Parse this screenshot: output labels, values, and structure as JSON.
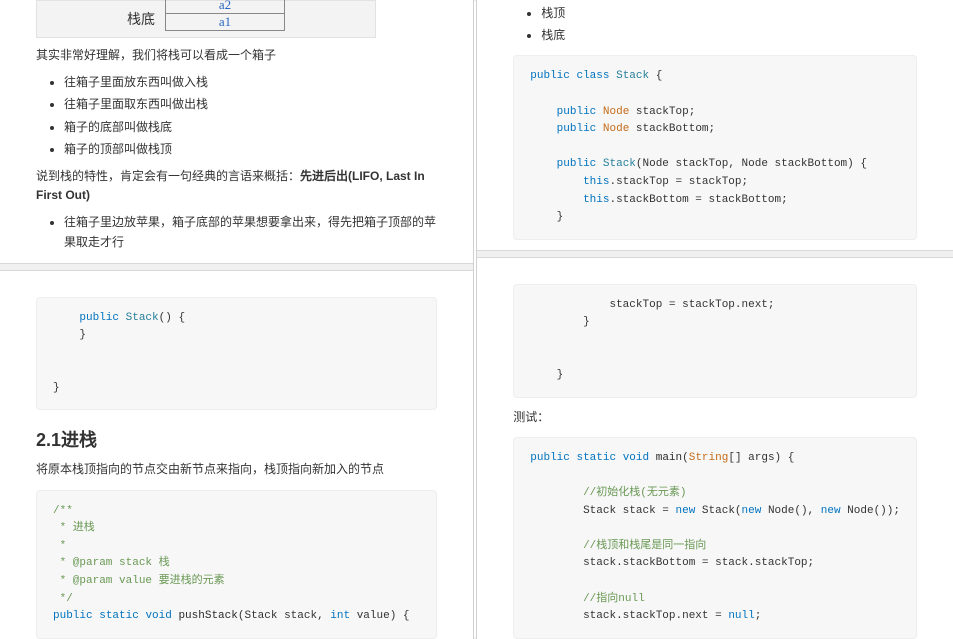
{
  "left_top": {
    "diagram": {
      "bottom_label": "栈底",
      "cell_a2": "a2",
      "cell_a1": "a1"
    },
    "p_intro": "其实非常好理解，我们将栈可以看成一个箱子",
    "bullets": [
      "往箱子里面放东西叫做入栈",
      "往箱子里面取东西叫做出栈",
      "箱子的底部叫做栈底",
      "箱子的顶部叫做栈顶"
    ],
    "p_trait_prefix": "说到栈的特性，肯定会有一句经典的言语来概括：",
    "p_trait_bold": "先进后出(LIFO, Last In First Out)",
    "bullet_apple": "往箱子里边放苹果，箱子底部的苹果想要拿出来，得先把箱子顶部的苹果取走才行"
  },
  "right_top": {
    "bullets": [
      "栈顶",
      "栈底"
    ],
    "code": {
      "l1a": "public",
      "l1b": "class",
      "l1c": "Stack",
      "l1d": "{",
      "l2a": "public",
      "l2b": "Node",
      "l2c": "stackTop;",
      "l3a": "public",
      "l3b": "Node",
      "l3c": "stackBottom;",
      "l4a": "public",
      "l4b": "Stack",
      "l4c": "(Node stackTop, Node stackBottom) {",
      "l5a": "this",
      "l5b": ".stackTop = stackTop;",
      "l6a": "this",
      "l6b": ".stackBottom = stackBottom;",
      "l7": "}"
    }
  },
  "left_bottom": {
    "code1": {
      "l1a": "public",
      "l1b": "Stack",
      "l1c": "() {",
      "l2": "}",
      "l3": "}"
    },
    "heading": "2.1进栈",
    "p": "将原本栈顶指向的节点交由新节点来指向，栈顶指向新加入的节点",
    "code2": {
      "c1": "/**",
      "c2": " * 进栈",
      "c3": " *",
      "c4": " * @param stack 栈",
      "c5": " * @param value 要进栈的元素",
      "c6": " */",
      "l1a": "public",
      "l1b": "static",
      "l1c": "void",
      "l1d": "pushStack",
      "l1e": "(Stack stack, ",
      "l1f": "int",
      "l1g": " value) {"
    }
  },
  "right_bottom": {
    "code1": {
      "l1": "stackTop = stackTop.next;",
      "l2": "}",
      "l3": "}"
    },
    "p_test": "测试：",
    "code2": {
      "l1a": "public",
      "l1b": "static",
      "l1c": "void",
      "l1d": "main",
      "l1e": "(",
      "l1f": "String",
      "l1g": "[] args) {",
      "c1": "//初始化栈(无元素)",
      "l2a": "Stack stack = ",
      "l2b": "new",
      "l2c": " Stack(",
      "l2d": "new",
      "l2e": " Node(), ",
      "l2f": "new",
      "l2g": " Node());",
      "c2": "//栈顶和栈尾是同一指向",
      "l3": "stack.stackBottom = stack.stackTop;",
      "c3": "//指向null",
      "l4a": "stack.stackTop.next = ",
      "l4b": "null",
      "l4c": ";"
    }
  }
}
